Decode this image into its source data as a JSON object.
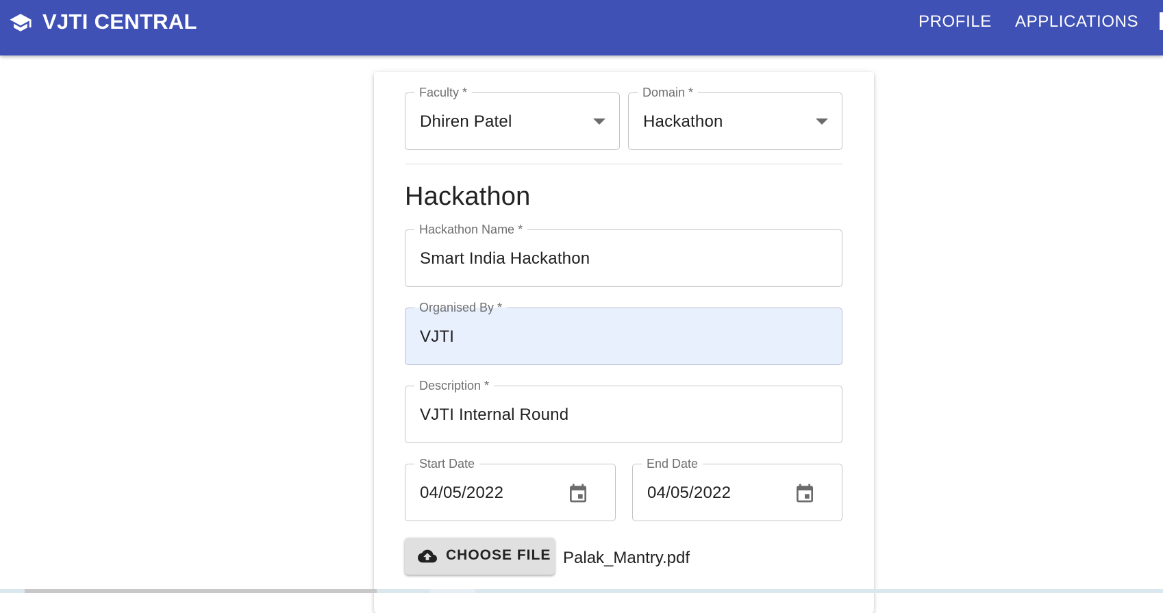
{
  "appbar": {
    "title": "VJTI CENTRAL",
    "nav": [
      "PROFILE",
      "APPLICATIONS"
    ],
    "bg_color": "#3f51b5"
  },
  "form": {
    "faculty": {
      "label": "Faculty *",
      "value": "Dhiren Patel"
    },
    "domain": {
      "label": "Domain *",
      "value": "Hackathon"
    },
    "section_title": "Hackathon",
    "hackathon_name": {
      "label": "Hackathon Name *",
      "value": "Smart India Hackathon"
    },
    "organised_by": {
      "label": "Organised By *",
      "value": "VJTI"
    },
    "description": {
      "label": "Description *",
      "value": "VJTI Internal Round"
    },
    "start_date": {
      "label": "Start Date",
      "value": "04/05/2022"
    },
    "end_date": {
      "label": "End Date",
      "value": "04/05/2022"
    },
    "choose_file_label": "CHOOSE FILE",
    "file_name": "Palak_Mantry.pdf"
  },
  "icons": {
    "brand": "graduation-cap-icon",
    "dropdown": "chevron-down-icon",
    "calendar": "calendar-icon",
    "upload": "cloud-upload-icon"
  }
}
